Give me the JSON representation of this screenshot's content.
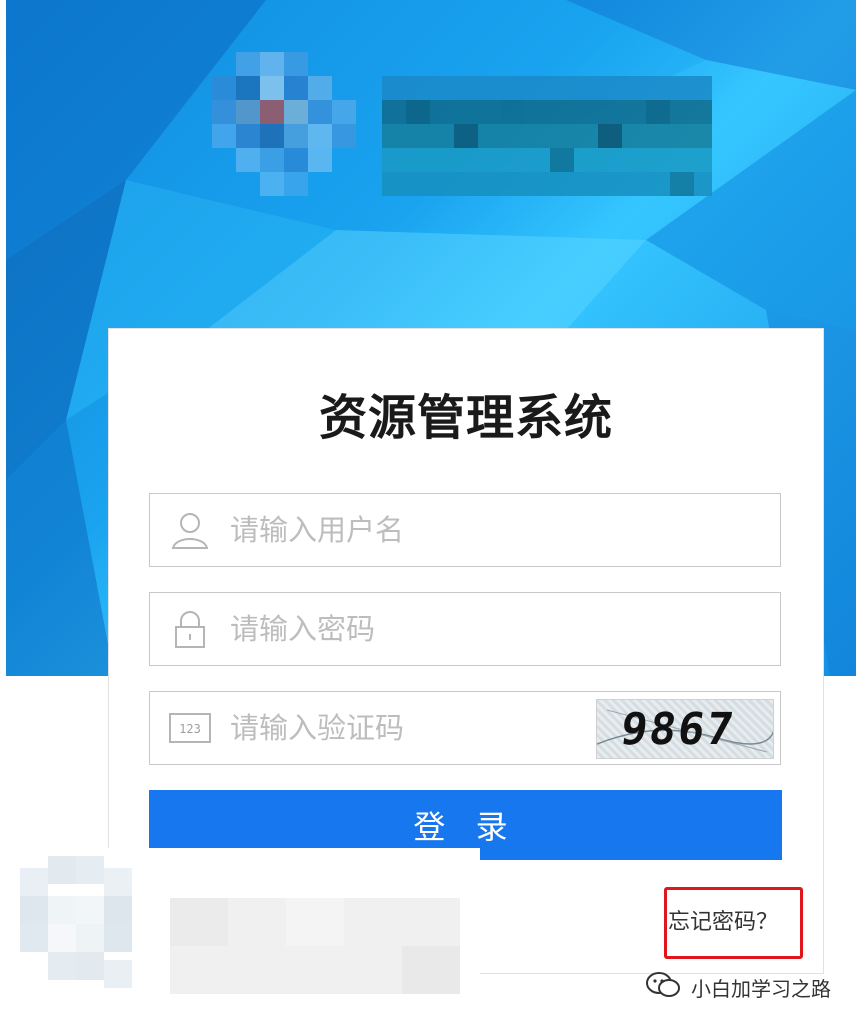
{
  "login": {
    "title": "资源管理系统",
    "username_placeholder": "请输入用户名",
    "password_placeholder": "请输入密码",
    "captcha_placeholder": "请输入验证码",
    "captcha_text": "9867",
    "code_icon_text": "123",
    "submit_label": "登 录",
    "forgot_label": "忘记密码？"
  },
  "watermark": {
    "text": "小白加学习之路"
  },
  "colors": {
    "banner": "#1aa3ef",
    "primary_button": "#1677ee",
    "highlight_box": "#e0161b"
  },
  "icons": [
    "user-icon",
    "lock-icon",
    "captcha-code-icon",
    "wechat-icon"
  ]
}
